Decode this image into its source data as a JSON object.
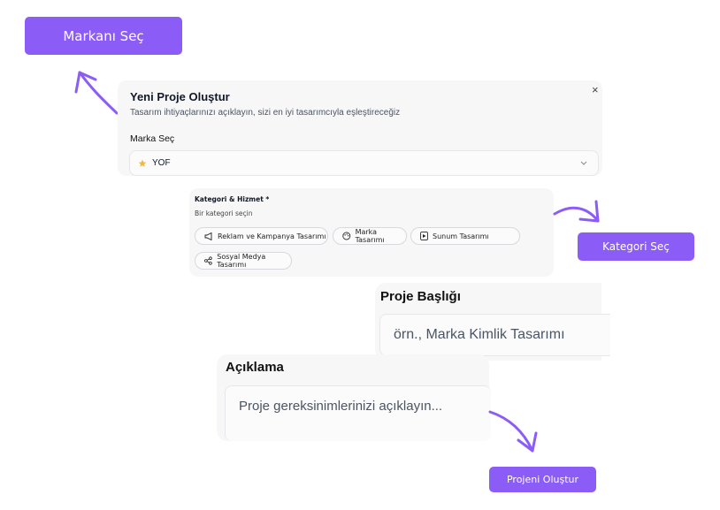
{
  "callouts": {
    "brand": "Markanı Seç",
    "category": "Kategori Seç",
    "create": "Projeni Oluştur"
  },
  "modal": {
    "title": "Yeni Proje Oluştur",
    "subtitle": "Tasarım ihtiyaçlarınızı açıklayın, sizi en iyi tasarımcıyla eşleştireceğiz",
    "close": "×",
    "brand_label": "Marka Seç",
    "brand_value": "YOF"
  },
  "category": {
    "label": "Kategori & Hizmet *",
    "hint": "Bir kategori seçin",
    "chips": [
      {
        "label": "Reklam ve Kampanya Tasarımı",
        "icon": "megaphone-icon"
      },
      {
        "label": "Marka Tasarımı",
        "icon": "palette-icon"
      },
      {
        "label": "Sunum Tasarımı",
        "icon": "presentation-icon"
      },
      {
        "label": "Sosyal Medya Tasarımı",
        "icon": "share-icon"
      }
    ]
  },
  "project_title": {
    "label": "Proje Başlığı",
    "placeholder": "örn., Marka Kimlik Tasarımı"
  },
  "description": {
    "label": "Açıklama",
    "placeholder": "Proje gereksinimlerinizi açıklayın..."
  },
  "colors": {
    "accent": "#8b5cf6",
    "star": "#f5b642"
  }
}
